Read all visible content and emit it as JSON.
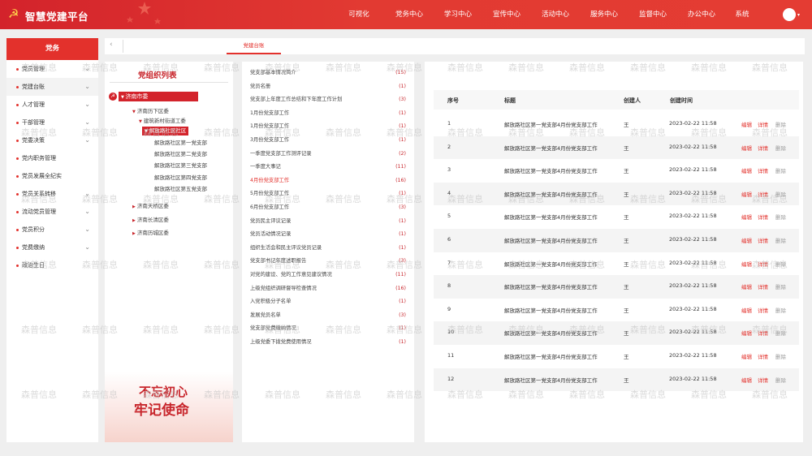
{
  "header": {
    "app_title": "智慧党建平台",
    "nav": [
      "可视化",
      "党务中心",
      "学习中心",
      "宣传中心",
      "活动中心",
      "服务中心",
      "监督中心",
      "办公中心",
      "系统"
    ]
  },
  "sidebar": {
    "title": "党务",
    "items": [
      {
        "label": "党员管理",
        "chevron": true
      },
      {
        "label": "党建台账",
        "chevron": true
      },
      {
        "label": "人才管理",
        "chevron": true
      },
      {
        "label": "干部管理",
        "chevron": true
      },
      {
        "label": "党委决策",
        "chevron": true
      },
      {
        "label": "党内职务管理",
        "chevron": false
      },
      {
        "label": "党员发展全纪实",
        "chevron": false
      },
      {
        "label": "党员关系转移",
        "chevron": true
      },
      {
        "label": "流动党员管理",
        "chevron": true
      },
      {
        "label": "党员积分",
        "chevron": true
      },
      {
        "label": "党费缴纳",
        "chevron": true
      },
      {
        "label": "政治生日",
        "chevron": false
      }
    ]
  },
  "tabs": {
    "active": "党建台账"
  },
  "tree": {
    "title": "党组织列表",
    "root": "济南市委",
    "nodes": [
      {
        "label": "济南历下区委",
        "arrow": true
      },
      {
        "label": "建筑新村街道工委",
        "arrow": true
      },
      {
        "label": "解放路社区社区",
        "arrow": true
      },
      {
        "label": "解放路社区第一党支部",
        "arrow": false
      },
      {
        "label": "解放路社区第二党支部",
        "arrow": false
      },
      {
        "label": "解放路社区第三党支部",
        "arrow": false
      },
      {
        "label": "解放路社区第四党支部",
        "arrow": false
      },
      {
        "label": "解放路社区第五党支部",
        "arrow": false
      },
      {
        "label": "济南天桥区委",
        "arrow": true
      },
      {
        "label": "济南长清区委",
        "arrow": true
      },
      {
        "label": "济南历城区委",
        "arrow": true
      }
    ],
    "banner": {
      "line1": "不忘初心",
      "line2": "牢记使命"
    }
  },
  "documents": [
    {
      "name": "党支部基本情况简介",
      "count": "(15)"
    },
    {
      "name": "党员名册",
      "count": "(1)"
    },
    {
      "name": "党支部上年度工作总结和下年度工作计划",
      "count": "(3)"
    },
    {
      "name": "1月份党支部工作",
      "count": "(1)"
    },
    {
      "name": "1月份党支部工作",
      "count": "(1)"
    },
    {
      "name": "3月份党支部工作",
      "count": "(1)"
    },
    {
      "name": "一季度党支部工作测评记录",
      "count": "(2)"
    },
    {
      "name": "一季度大事记",
      "count": "(11)"
    },
    {
      "name": "4月份党支部工作",
      "count": "(16)"
    },
    {
      "name": "5月份党支部工作",
      "count": "(1)"
    },
    {
      "name": "6月份党支部工作",
      "count": "(3)"
    },
    {
      "name": "党员民主评议记录",
      "count": "(1)"
    },
    {
      "name": "党员活动情况记录",
      "count": "(1)"
    },
    {
      "name": "组织生活会和民主评议党员记录",
      "count": "(1)"
    },
    {
      "name": "党支部书记年度述职报告",
      "count": "(3)"
    },
    {
      "name": "对党的建设、党的工作意见建议情况",
      "count": "(11)"
    },
    {
      "name": "上级党组织调研督导检查情况",
      "count": "(16)"
    },
    {
      "name": "入党积极分子名单",
      "count": "(1)"
    },
    {
      "name": "发展党员名单",
      "count": "(3)"
    },
    {
      "name": "党支部党费缴纳情况",
      "count": "(1)"
    },
    {
      "name": "上级党委下拨党费使用情况",
      "count": "(1)"
    }
  ],
  "table": {
    "columns": [
      "序号",
      "标题",
      "创建人",
      "创建时间"
    ],
    "actions": [
      "编辑",
      "详情",
      "删除"
    ],
    "rows": [
      {
        "no": "1",
        "title": "解放路社区第一党支部4月份党支部工作",
        "creator": "王",
        "time": "2023-02-22  11:58"
      },
      {
        "no": "2",
        "title": "解放路社区第一党支部4月份党支部工作",
        "creator": "王",
        "time": "2023-02-22  11:58"
      },
      {
        "no": "3",
        "title": "解放路社区第一党支部4月份党支部工作",
        "creator": "王",
        "time": "2023-02-22  11:58"
      },
      {
        "no": "4",
        "title": "解放路社区第一党支部4月份党支部工作",
        "creator": "王",
        "time": "2023-02-22  11:58"
      },
      {
        "no": "5",
        "title": "解放路社区第一党支部4月份党支部工作",
        "creator": "王",
        "time": "2023-02-22  11:58"
      },
      {
        "no": "6",
        "title": "解放路社区第一党支部4月份党支部工作",
        "creator": "王",
        "time": "2023-02-22  11:58"
      },
      {
        "no": "7",
        "title": "解放路社区第一党支部4月份党支部工作",
        "creator": "王",
        "time": "2023-02-22  11:58"
      },
      {
        "no": "8",
        "title": "解放路社区第一党支部4月份党支部工作",
        "creator": "王",
        "time": "2023-02-22  11:58"
      },
      {
        "no": "9",
        "title": "解放路社区第一党支部4月份党支部工作",
        "creator": "王",
        "time": "2023-02-22  11:58"
      },
      {
        "no": "10",
        "title": "解放路社区第一党支部4月份党支部工作",
        "creator": "王",
        "time": "2023-02-22  11:58"
      },
      {
        "no": "11",
        "title": "解放路社区第一党支部4月份党支部工作",
        "creator": "王",
        "time": "2023-02-22  11:58"
      },
      {
        "no": "12",
        "title": "解放路社区第一党支部4月份党支部工作",
        "creator": "王",
        "time": "2023-02-22  11:58"
      }
    ]
  },
  "watermark": "森普信息",
  "colors": {
    "brand_red": "#e3312c",
    "header_red": "#d3232b",
    "gold": "#ffd24a"
  }
}
